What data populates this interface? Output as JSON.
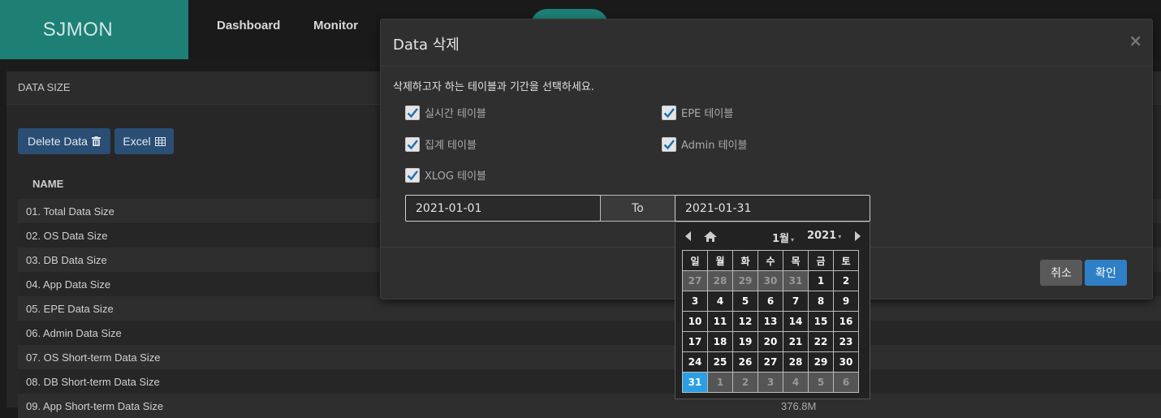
{
  "app": {
    "logo": "SJMON"
  },
  "nav": {
    "items": [
      "Dashboard",
      "Monitor"
    ]
  },
  "panel": {
    "title": "DATA SIZE",
    "delete_button": "Delete Data",
    "excel_button": "Excel",
    "column_name": "NAME",
    "rows": [
      {
        "name": "01. Total Data Size",
        "value": ""
      },
      {
        "name": "02. OS Data Size",
        "value": ""
      },
      {
        "name": "03. DB Data Size",
        "value": ""
      },
      {
        "name": "04. App Data Size",
        "value": ""
      },
      {
        "name": "05. EPE Data Size",
        "value": ""
      },
      {
        "name": "06. Admin Data Size",
        "value": ""
      },
      {
        "name": "07. OS Short-term Data Size",
        "value": ""
      },
      {
        "name": "08. DB Short-term Data Size",
        "value": ""
      },
      {
        "name": "09. App Short-term Data Size",
        "value": "376.8M"
      }
    ]
  },
  "modal": {
    "title": "Data 삭제",
    "close": "×",
    "description": "삭제하고자 하는 테이블과 기간을 선택하세요.",
    "checkboxes": [
      {
        "label": "실시간 테이블",
        "checked": true
      },
      {
        "label": "EPE 테이블",
        "checked": true
      },
      {
        "label": "집계 테이블",
        "checked": true
      },
      {
        "label": "Admin 테이블",
        "checked": true
      },
      {
        "label": "XLOG 테이블",
        "checked": true
      }
    ],
    "date_from": "2021-01-01",
    "to_label": "To",
    "date_to": "2021-01-31",
    "cancel": "취소",
    "confirm": "확인"
  },
  "calendar": {
    "month": "1월",
    "year": "2021",
    "weekdays": [
      "일",
      "월",
      "화",
      "수",
      "목",
      "금",
      "토"
    ],
    "weeks": [
      [
        "27",
        "28",
        "29",
        "30",
        "31",
        "1",
        "2"
      ],
      [
        "3",
        "4",
        "5",
        "6",
        "7",
        "8",
        "9"
      ],
      [
        "10",
        "11",
        "12",
        "13",
        "14",
        "15",
        "16"
      ],
      [
        "17",
        "18",
        "19",
        "20",
        "21",
        "22",
        "23"
      ],
      [
        "24",
        "25",
        "26",
        "27",
        "28",
        "29",
        "30"
      ],
      [
        "31",
        "1",
        "2",
        "3",
        "4",
        "5",
        "6"
      ]
    ],
    "selected": "31"
  },
  "colors": {
    "accent": "#1e7f75",
    "primary": "#2f7fc6",
    "selected_day": "#2a9fe6"
  }
}
